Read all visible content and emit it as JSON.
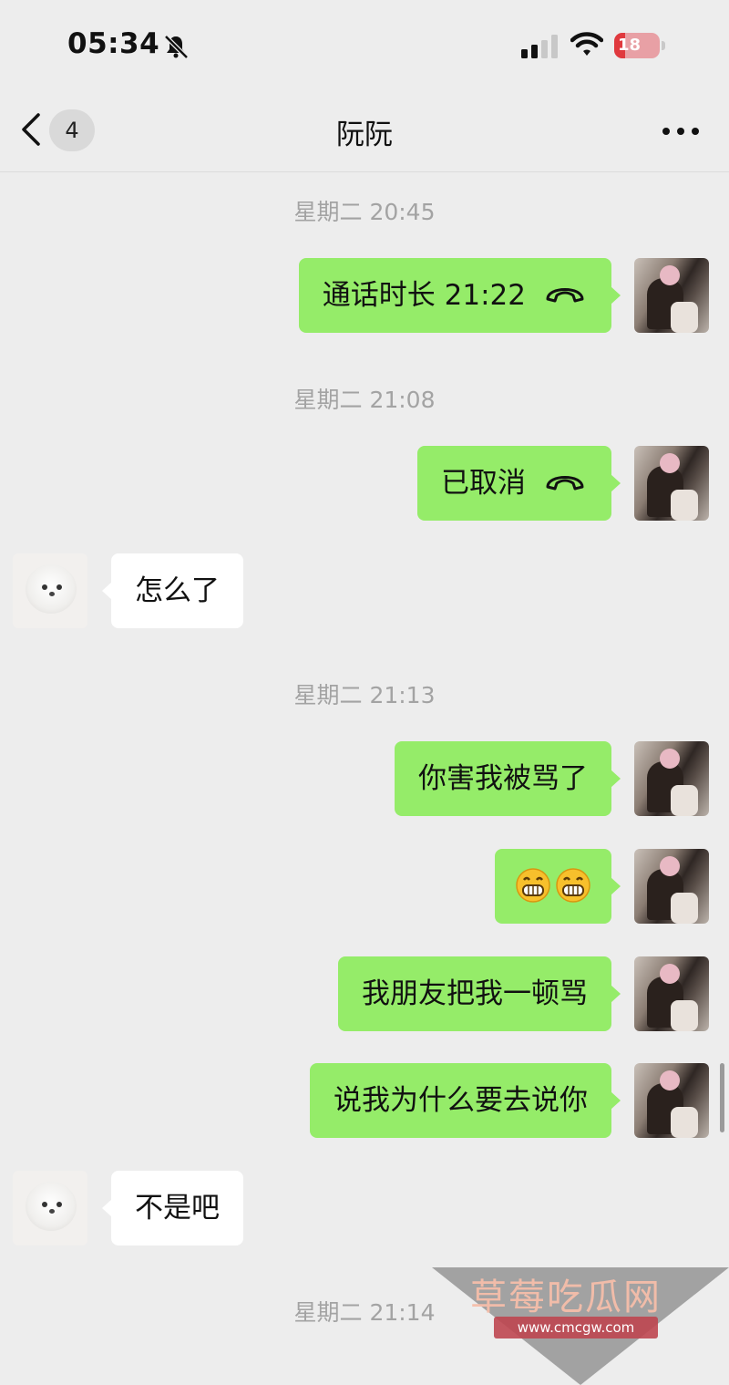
{
  "status_bar": {
    "time": "05:34",
    "battery_level": "18",
    "icons": [
      "bell-slash-icon",
      "cellular-signal-icon",
      "wifi-icon",
      "battery-charging-icon"
    ]
  },
  "nav": {
    "unread_count": "4",
    "title": "阮阮",
    "icons": [
      "back-chevron-icon",
      "more-dots-icon"
    ]
  },
  "messages": [
    {
      "type": "timestamp",
      "text": "星期二 20:45"
    },
    {
      "type": "call",
      "from": "me",
      "text": "通话时长 21:22"
    },
    {
      "type": "timestamp",
      "text": "星期二 21:08"
    },
    {
      "type": "call",
      "from": "me",
      "text": "已取消"
    },
    {
      "type": "text",
      "from": "other",
      "text": "怎么了"
    },
    {
      "type": "timestamp",
      "text": "星期二 21:13"
    },
    {
      "type": "text",
      "from": "me",
      "text": "你害我被骂了"
    },
    {
      "type": "emoji",
      "from": "me",
      "emoji": [
        "grin-emoji",
        "grin-emoji"
      ]
    },
    {
      "type": "text",
      "from": "me",
      "text": "我朋友把我一顿骂"
    },
    {
      "type": "text",
      "from": "me",
      "text": "说我为什么要去说你"
    },
    {
      "type": "text",
      "from": "other",
      "text": "不是吧"
    },
    {
      "type": "timestamp",
      "text": "星期二 21:14"
    }
  ],
  "watermark": {
    "name": "草莓吃瓜网",
    "url": "www.cmcgw.com"
  },
  "colors": {
    "background": "#ededed",
    "my_bubble": "#95ec69",
    "other_bubble": "#ffffff",
    "timestamp": "#a3a3a3",
    "battery_low": "#e0393e"
  }
}
